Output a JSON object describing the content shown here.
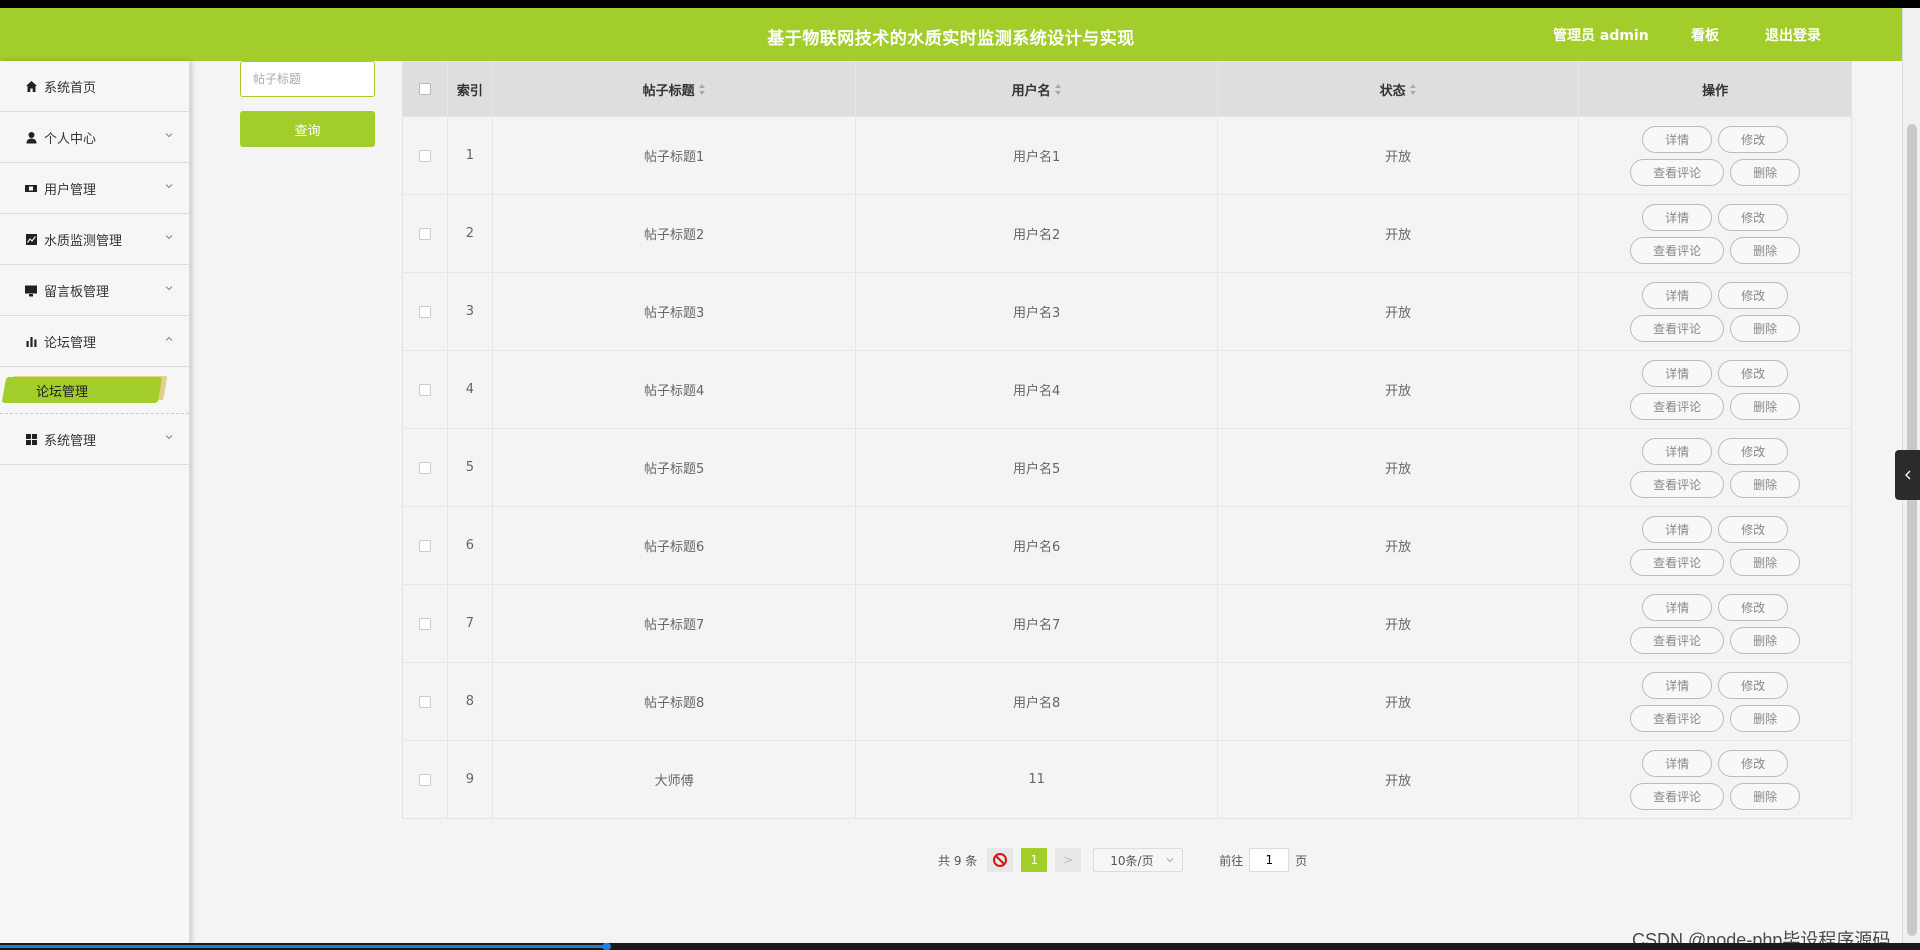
{
  "header": {
    "title": "基于物联网技术的水质实时监测系统设计与实现",
    "admin": "管理员 admin",
    "board_link": "看板",
    "logout_link": "退出登录",
    "color": "#a3cd2a"
  },
  "sidebar": {
    "items": [
      {
        "label": "系统首页",
        "icon": "home-icon"
      },
      {
        "label": "个人中心",
        "icon": "user-icon"
      },
      {
        "label": "用户管理",
        "icon": "users-icon"
      },
      {
        "label": "水质监测管理",
        "icon": "chart-line-icon"
      },
      {
        "label": "留言板管理",
        "icon": "monitor-icon"
      },
      {
        "label": "论坛管理",
        "icon": "bar-chart-icon",
        "expanded": true
      },
      {
        "label": "系统管理",
        "icon": "grid-icon"
      }
    ],
    "sub_items": [
      {
        "label": "论坛管理",
        "active": true
      }
    ]
  },
  "search": {
    "placeholder": "帖子标题",
    "button_label": "查询"
  },
  "table": {
    "headers": {
      "index": "索引",
      "title": "帖子标题",
      "username": "用户名",
      "status": "状态",
      "actions": "操作"
    },
    "rows": [
      {
        "index": "1",
        "title": "帖子标题1",
        "username": "用户名1",
        "status": "开放"
      },
      {
        "index": "2",
        "title": "帖子标题2",
        "username": "用户名2",
        "status": "开放"
      },
      {
        "index": "3",
        "title": "帖子标题3",
        "username": "用户名3",
        "status": "开放"
      },
      {
        "index": "4",
        "title": "帖子标题4",
        "username": "用户名4",
        "status": "开放"
      },
      {
        "index": "5",
        "title": "帖子标题5",
        "username": "用户名5",
        "status": "开放"
      },
      {
        "index": "6",
        "title": "帖子标题6",
        "username": "用户名6",
        "status": "开放"
      },
      {
        "index": "7",
        "title": "帖子标题7",
        "username": "用户名7",
        "status": "开放"
      },
      {
        "index": "8",
        "title": "帖子标题8",
        "username": "用户名8",
        "status": "开放"
      },
      {
        "index": "9",
        "title": "大师傅",
        "username": "11",
        "status": "开放"
      }
    ],
    "actions": {
      "detail": "详情",
      "edit": "修改",
      "comments": "查看评论",
      "delete": "删除"
    }
  },
  "pagination": {
    "total": "共 9 条",
    "current_page": "1",
    "next": ">",
    "page_size": "10条/页",
    "goto_label": "前往",
    "goto_value": "1",
    "goto_suffix": "页"
  },
  "watermark": "CSDN @node-php毕设程序源码"
}
